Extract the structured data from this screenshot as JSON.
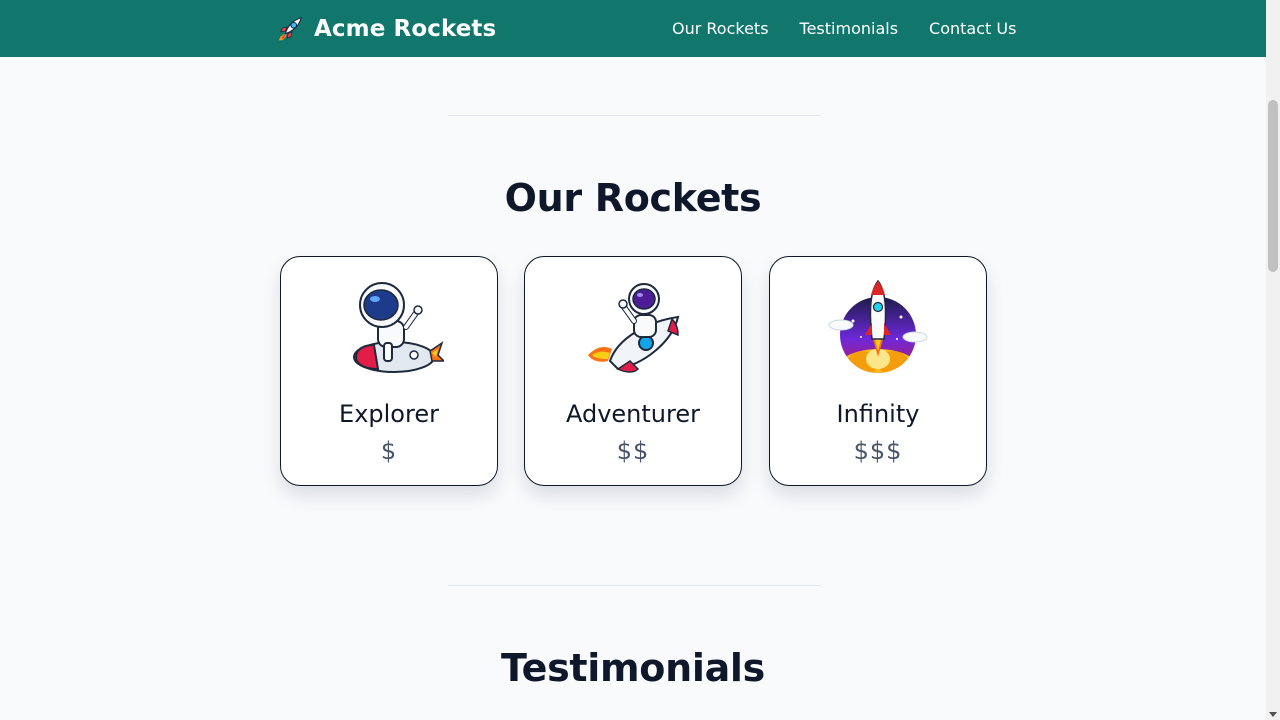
{
  "navbar": {
    "brand": "Acme Rockets",
    "brand_icon": "rocket-icon",
    "background": "#11766c",
    "links": [
      "Our Rockets",
      "Testimonials",
      "Contact Us"
    ]
  },
  "sections": {
    "rockets_title": "Our Rockets",
    "testimonials_title": "Testimonials"
  },
  "rockets": [
    {
      "name": "Explorer",
      "price": "$",
      "image": "astronaut-riding-rocket-image"
    },
    {
      "name": "Adventurer",
      "price": "$$",
      "image": "astronaut-waving-on-rocket-image"
    },
    {
      "name": "Infinity",
      "price": "$$$",
      "image": "rocket-launch-image"
    }
  ]
}
